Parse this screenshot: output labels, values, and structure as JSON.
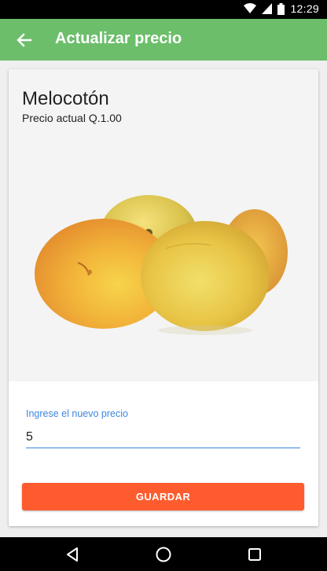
{
  "status_bar": {
    "time": "12:29",
    "icons": [
      "wifi-icon",
      "signal-icon",
      "battery-icon"
    ]
  },
  "app_bar": {
    "title": "Actualizar precio",
    "back_icon": "arrow-back-icon",
    "color": "#6cbe6b"
  },
  "product": {
    "name": "Melocotón",
    "current_price": "Precio actual Q.1.00",
    "image": "peach-illustration"
  },
  "form": {
    "label": "Ingrese el nuevo precio",
    "value": "5",
    "accent": "#3f87e0"
  },
  "actions": {
    "save_label": "GUARDAR",
    "save_color": "#fe5c2e"
  },
  "nav_bar": {
    "icons": [
      "back-triangle-icon",
      "home-circle-icon",
      "recents-square-icon"
    ]
  }
}
